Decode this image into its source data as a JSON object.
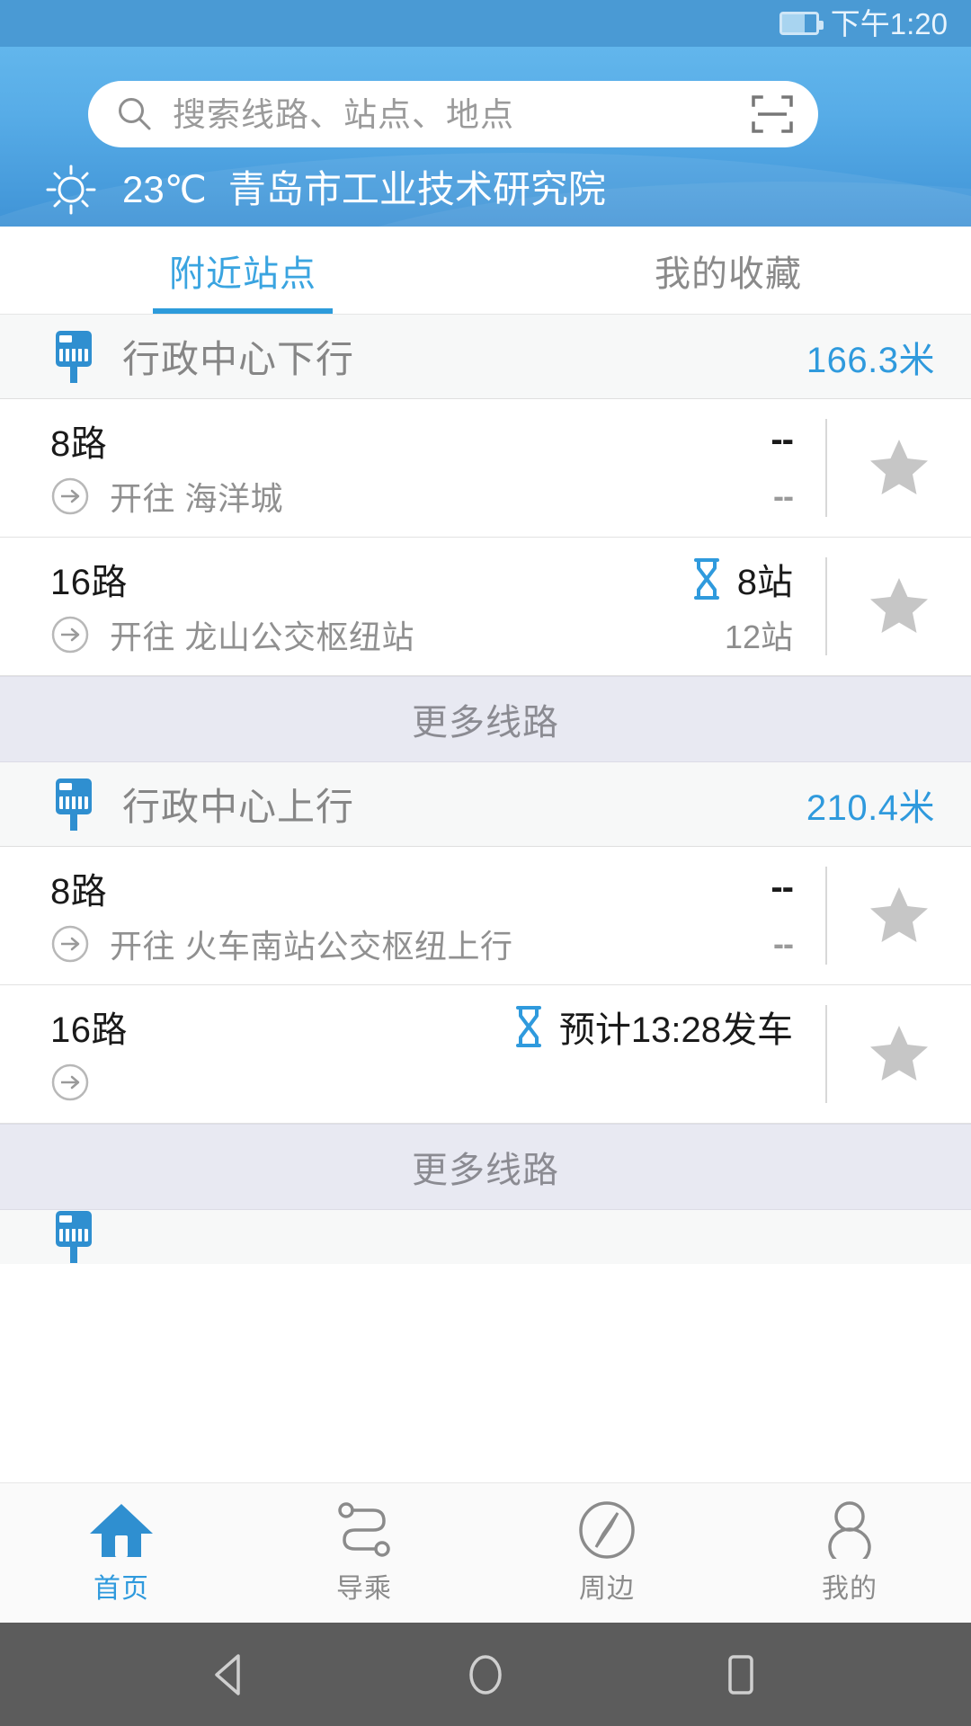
{
  "status_bar": {
    "time": "下午1:20",
    "battery_icon": "battery-icon",
    "battery_level_pct": 66
  },
  "header": {
    "search": {
      "placeholder": "搜索线路、站点、地点",
      "search_icon": "search-icon",
      "scan_icon": "scan-qr-icon"
    },
    "weather": {
      "icon": "sun-icon",
      "temperature": "23℃",
      "location": "青岛市工业技术研究院"
    }
  },
  "tabs": [
    {
      "label": "附近站点",
      "active": true
    },
    {
      "label": "我的收藏",
      "active": false
    }
  ],
  "colors": {
    "accent": "#2f9add",
    "header_blue": "#57ace7",
    "status_blue": "#4a9ad4",
    "more_bg": "#e8e9f2",
    "star_gray": "#c6c6c6"
  },
  "stations": [
    {
      "name": "行政中心下行",
      "distance": "166.3米",
      "icon": "bus-stop-icon",
      "routes": [
        {
          "name": "8路",
          "direction_prefix": "开往",
          "destination": "海洋城",
          "eta_primary": "--",
          "eta_primary_is_dashes": true,
          "eta_secondary": "--",
          "eta_secondary_is_dashes": true,
          "has_hourglass": false,
          "favorite_icon": "star-icon",
          "favorited": false
        },
        {
          "name": "16路",
          "direction_prefix": "开往",
          "destination": "龙山公交枢纽站",
          "eta_primary": "8站",
          "eta_primary_is_dashes": false,
          "eta_secondary": "12站",
          "eta_secondary_is_dashes": false,
          "has_hourglass": true,
          "favorite_icon": "star-icon",
          "favorited": false
        }
      ],
      "more_label": "更多线路"
    },
    {
      "name": "行政中心上行",
      "distance": "210.4米",
      "icon": "bus-stop-icon",
      "routes": [
        {
          "name": "8路",
          "direction_prefix": "开往",
          "destination": "火车南站公交枢纽上行",
          "eta_primary": "--",
          "eta_primary_is_dashes": true,
          "eta_secondary": "--",
          "eta_secondary_is_dashes": true,
          "has_hourglass": false,
          "favorite_icon": "star-icon",
          "favorited": false
        },
        {
          "name": "16路",
          "direction_prefix": "",
          "destination": "",
          "eta_primary": "预计13:28发车",
          "eta_primary_is_dashes": false,
          "eta_secondary": "",
          "eta_secondary_is_dashes": false,
          "has_hourglass": true,
          "favorite_icon": "star-icon",
          "favorited": false
        }
      ],
      "more_label": "更多线路"
    }
  ],
  "bottom_nav": [
    {
      "label": "首页",
      "icon": "home-icon",
      "active": true
    },
    {
      "label": "导乘",
      "icon": "route-transfer-icon",
      "active": false
    },
    {
      "label": "周边",
      "icon": "compass-icon",
      "active": false
    },
    {
      "label": "我的",
      "icon": "person-icon",
      "active": false
    }
  ],
  "system_bar": [
    {
      "name": "back-button",
      "icon": "triangle-back-icon"
    },
    {
      "name": "home-button",
      "icon": "circle-home-icon"
    },
    {
      "name": "recents-button",
      "icon": "square-recents-icon"
    }
  ]
}
